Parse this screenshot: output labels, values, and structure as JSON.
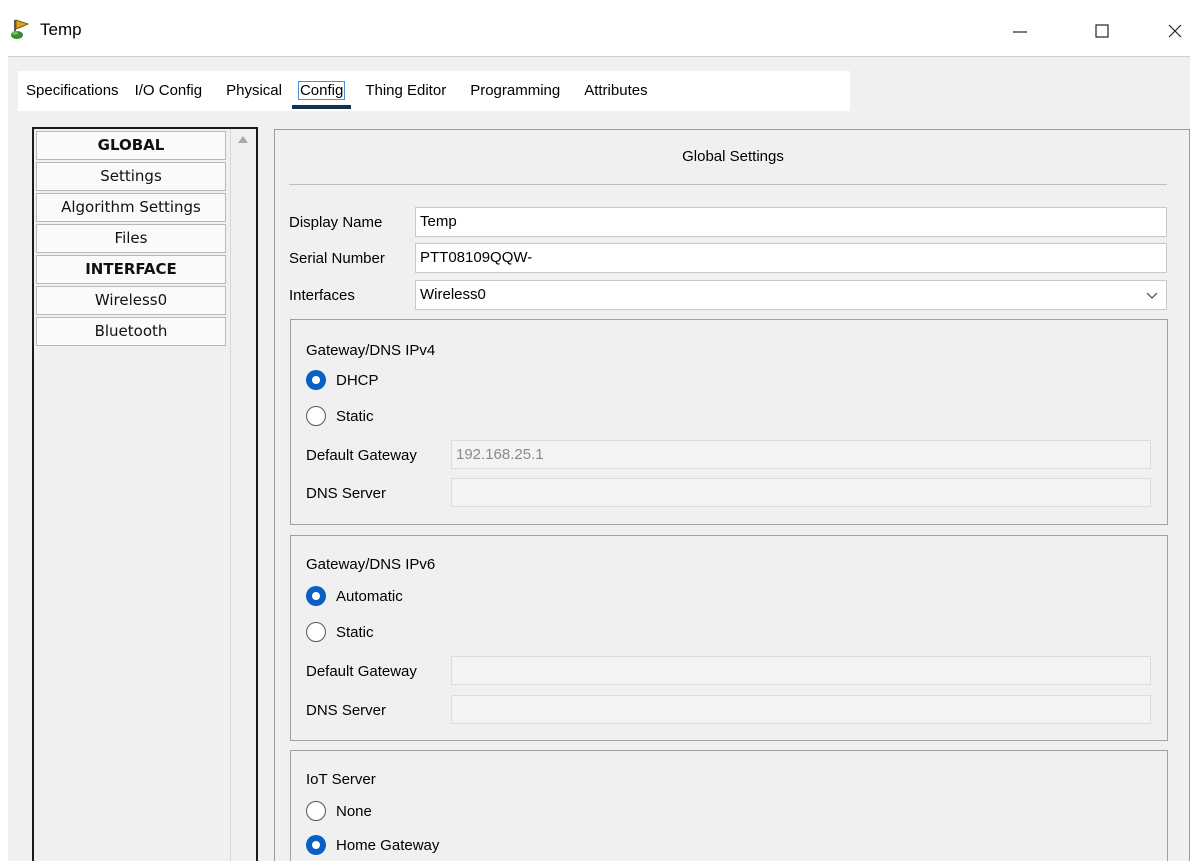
{
  "window": {
    "title": "Temp",
    "icon": "packet-tracer-thing-icon",
    "controls": {
      "minimize": "minimize-icon",
      "maximize": "maximize-icon",
      "close": "close-icon"
    }
  },
  "tabs": [
    {
      "label": "Specifications",
      "active": false
    },
    {
      "label": "I/O Config",
      "active": false
    },
    {
      "label": "Physical",
      "active": false
    },
    {
      "label": "Config",
      "active": true
    },
    {
      "label": "Thing Editor",
      "active": false
    },
    {
      "label": "Programming",
      "active": false
    },
    {
      "label": "Attributes",
      "active": false
    }
  ],
  "sidebar": {
    "items": [
      {
        "label": "GLOBAL",
        "header": true
      },
      {
        "label": "Settings",
        "header": false
      },
      {
        "label": "Algorithm Settings",
        "header": false
      },
      {
        "label": "Files",
        "header": false
      },
      {
        "label": "INTERFACE",
        "header": true
      },
      {
        "label": "Wireless0",
        "header": false
      },
      {
        "label": "Bluetooth",
        "header": false
      }
    ]
  },
  "panel": {
    "title": "Global Settings",
    "display_name": {
      "label": "Display Name",
      "value": "Temp"
    },
    "serial_number": {
      "label": "Serial Number",
      "value": "PTT08109QQW-"
    },
    "interfaces": {
      "label": "Interfaces",
      "value": "Wireless0"
    },
    "ipv4": {
      "title": "Gateway/DNS IPv4",
      "options": [
        {
          "label": "DHCP",
          "selected": true
        },
        {
          "label": "Static",
          "selected": false
        }
      ],
      "default_gateway": {
        "label": "Default Gateway",
        "value": "192.168.25.1"
      },
      "dns_server": {
        "label": "DNS Server",
        "value": ""
      }
    },
    "ipv6": {
      "title": "Gateway/DNS IPv6",
      "options": [
        {
          "label": "Automatic",
          "selected": true
        },
        {
          "label": "Static",
          "selected": false
        }
      ],
      "default_gateway": {
        "label": "Default Gateway",
        "value": ""
      },
      "dns_server": {
        "label": "DNS Server",
        "value": ""
      }
    },
    "iot_server": {
      "title": "IoT Server",
      "options": [
        {
          "label": "None",
          "selected": false
        },
        {
          "label": "Home Gateway",
          "selected": true
        }
      ]
    }
  },
  "colors": {
    "accent": "#0a5fc4",
    "tab_underline": "#12304f",
    "background": "#f0f0f0"
  }
}
